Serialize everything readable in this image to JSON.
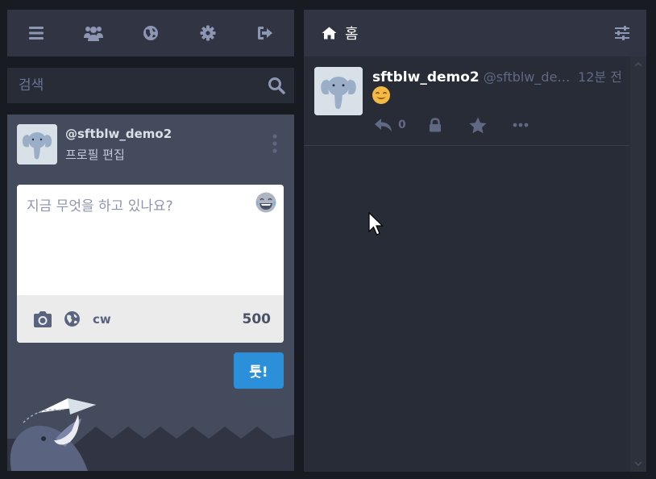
{
  "nav": {
    "menu_icon": "menu-icon",
    "people_icon": "people-icon",
    "globe_icon": "globe-icon",
    "settings_icon": "gear-icon",
    "logout_icon": "logout-icon"
  },
  "search": {
    "placeholder": "검색"
  },
  "account": {
    "handle": "@sftblw_demo2",
    "edit_profile": "프로필 편집"
  },
  "compose": {
    "placeholder": "지금 무엇을 하고 있나요?",
    "cw_label": "cw",
    "char_count": "500",
    "submit_label": "툿!"
  },
  "home_column": {
    "title": "홈"
  },
  "status": {
    "display_name": "sftblw_demo2",
    "acct": "@sftblw_demo2",
    "timestamp": "12분 전",
    "reply_count": "0"
  },
  "colors": {
    "accent": "#2b90d9",
    "panel_dark": "#282c37",
    "panel_header": "#313543",
    "compose_bg": "#444b5d",
    "icon_muted": "#8d96b2"
  }
}
